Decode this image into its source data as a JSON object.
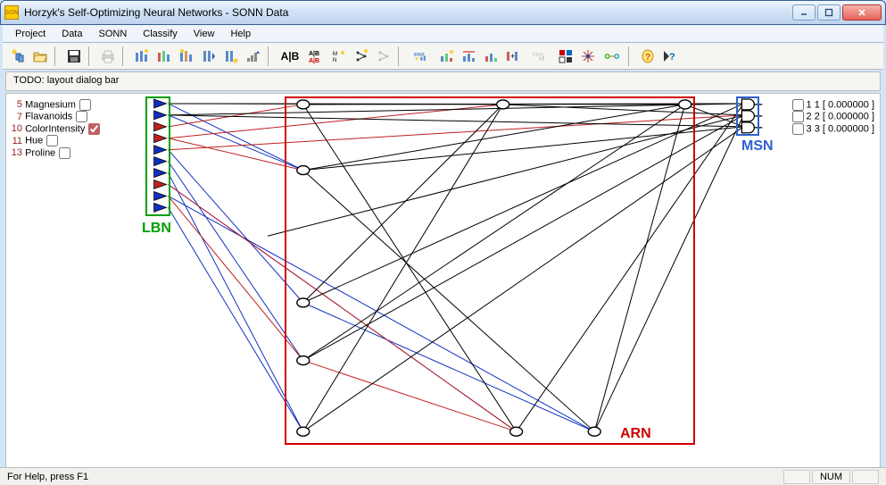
{
  "window": {
    "title": "Horzyk's Self-Optimizing Neural Networks - SONN Data",
    "icon_text": "SON"
  },
  "menu": [
    "Project",
    "Data",
    "SONN",
    "Classify",
    "View",
    "Help"
  ],
  "dialogbar": "TODO: layout dialog bar",
  "inputs": [
    {
      "n": "5",
      "name": "Magnesium",
      "checked": false
    },
    {
      "n": "7",
      "name": "Flavanoids",
      "checked": false
    },
    {
      "n": "10",
      "name": "ColorIntensity",
      "checked": true
    },
    {
      "n": "11",
      "name": "Hue",
      "checked": false
    },
    {
      "n": "13",
      "name": "Proline",
      "checked": false
    }
  ],
  "outputs": [
    {
      "a": "1",
      "b": "1",
      "val": "[ 0.000000 ]"
    },
    {
      "a": "2",
      "b": "2",
      "val": "[ 0.000000 ]"
    },
    {
      "a": "3",
      "b": "3",
      "val": "[ 0.000000 ]"
    }
  ],
  "labels": {
    "lbn": "LBN",
    "arn": "ARN",
    "msn": "MSN"
  },
  "statusbar": {
    "help": "For Help, press F1",
    "num": "NUM"
  },
  "toolbar_text": {
    "ab": "A|B",
    "stat": "STAT"
  },
  "colors": {
    "lbn": "#00a000",
    "arn": "#d00000",
    "msn": "#3060d0"
  }
}
